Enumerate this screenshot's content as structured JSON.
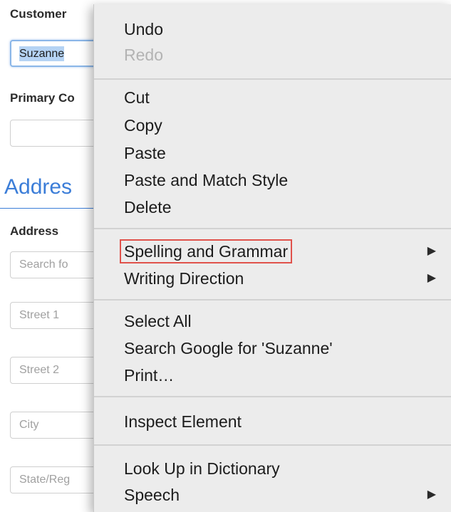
{
  "form": {
    "customer_label": "Customer",
    "customer_value": "Suzanne",
    "primary_contact_label": "Primary Co",
    "primary_contact_value": "",
    "section_heading": "Addres",
    "address_label": "Address",
    "search_placeholder": "Search fo",
    "street1_placeholder": "Street 1",
    "street2_placeholder": "Street 2",
    "city_placeholder": "City",
    "state_placeholder": "State/Reg"
  },
  "context_menu": {
    "groups": [
      [
        {
          "label": "Undo",
          "enabled": true
        },
        {
          "label": "Redo",
          "enabled": false
        }
      ],
      [
        {
          "label": "Cut",
          "enabled": true
        },
        {
          "label": "Copy",
          "enabled": true
        },
        {
          "label": "Paste",
          "enabled": true
        },
        {
          "label": "Paste and Match Style",
          "enabled": true
        },
        {
          "label": "Delete",
          "enabled": true
        }
      ],
      [
        {
          "label": "Spelling and Grammar",
          "enabled": true,
          "submenu": true,
          "highlighted": true
        },
        {
          "label": "Writing Direction",
          "enabled": true,
          "submenu": true
        }
      ],
      [
        {
          "label": "Select All",
          "enabled": true
        },
        {
          "label": "Search Google for 'Suzanne'",
          "enabled": true
        },
        {
          "label": "Print…",
          "enabled": true
        }
      ],
      [
        {
          "label": "Inspect Element",
          "enabled": true
        }
      ],
      [
        {
          "label": "Look Up in Dictionary",
          "enabled": true
        },
        {
          "label": "Speech",
          "enabled": true,
          "submenu": true
        }
      ]
    ],
    "submenu_arrow_icon": "triangle-right-icon",
    "highlight_color": "#e0524b"
  }
}
